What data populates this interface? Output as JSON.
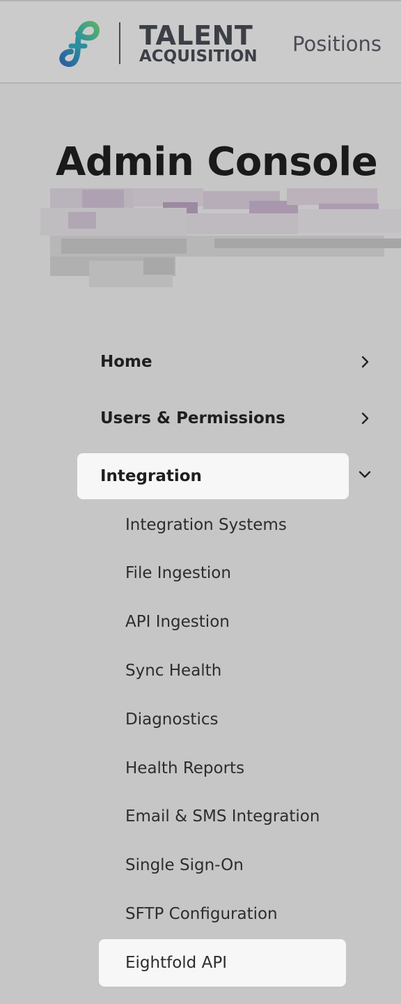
{
  "header": {
    "logo_line1": "TALENT",
    "logo_line2": "ACQUISITION",
    "nav_positions": "Positions"
  },
  "page": {
    "title": "Admin Console"
  },
  "sidebar": {
    "items": [
      {
        "label": "Home",
        "state": "collapsed"
      },
      {
        "label": "Users & Permissions",
        "state": "collapsed"
      },
      {
        "label": "Integration",
        "state": "expanded",
        "active": true
      }
    ],
    "integration_subitems": [
      "Integration Systems",
      "File Ingestion",
      "API Ingestion",
      "Sync Health",
      "Diagnostics",
      "Health Reports",
      "Email & SMS Integration",
      "Single Sign-On",
      "SFTP Configuration",
      "Eightfold API"
    ],
    "active_subitem": "Eightfold API"
  },
  "colors": {
    "background": "#c6c6c6",
    "active_item_bg": "#f7f7f7",
    "logo_teal": "#2a8fa0",
    "logo_green": "#58b06a",
    "logo_blue": "#2b5f9e"
  },
  "icons": {
    "logo": "infinity-logo-icon",
    "collapsed_chevron": "chevron-right-icon",
    "expanded_chevron": "chevron-down-icon"
  }
}
